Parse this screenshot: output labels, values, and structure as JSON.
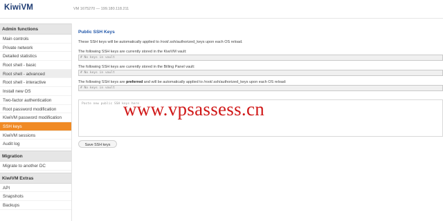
{
  "header": {
    "brand": "KiwiVM",
    "vm_info": "VM 1675270 — 199.180.118.211"
  },
  "sidebar": {
    "admin_title": "Admin functions",
    "admin_items": [
      "Main controls",
      "Private network",
      "Detailed statistics",
      "Root shell - basic",
      "Root shell - advanced",
      "Root shell - interactive",
      "Install new OS",
      "Two-factor authentication",
      "Root password modification",
      "KiwiVM password modification",
      "SSH keys",
      "KiwiVM sessions",
      "Audit log"
    ],
    "migration_title": "Migration",
    "migration_items": [
      "Migrate to another DC"
    ],
    "extras_title": "KiwiVM Extras",
    "extras_items": [
      "API",
      "Snapshots",
      "Backups"
    ]
  },
  "main": {
    "title": "Public SSH Keys",
    "intro": "These SSH keys will be automatically applied to /root/.ssh/authorized_keys upon each OS reload.",
    "kiwivm_label": "The following SSH keys are currently stored in the KiwiVM vault:",
    "kiwivm_value": "# No keys in vault",
    "billing_label": "The following SSH keys are currently stored in the Billing Panel vault:",
    "billing_value": "# No keys in vault",
    "preferred_prefix": "The following SSH keys are ",
    "preferred_bold": "preferred",
    "preferred_suffix": " and will be automatically applied to /root/.ssh/authorized_keys upon each OS reload:",
    "preferred_value": "# No keys in vault",
    "paste_placeholder": "Paste new public SSH keys here",
    "save_button": "Save SSH keys"
  },
  "watermark": "www.vpsassess.cn"
}
